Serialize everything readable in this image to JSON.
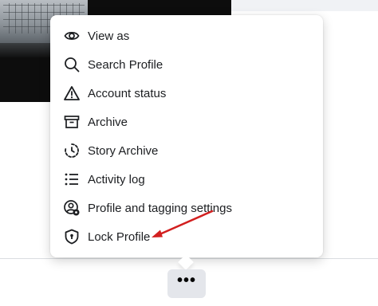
{
  "menu": {
    "items": [
      {
        "label": "View as",
        "icon": "eye-icon"
      },
      {
        "label": "Search Profile",
        "icon": "search-icon"
      },
      {
        "label": "Account status",
        "icon": "warning-icon"
      },
      {
        "label": "Archive",
        "icon": "archive-icon"
      },
      {
        "label": "Story Archive",
        "icon": "story-archive-icon"
      },
      {
        "label": "Activity log",
        "icon": "list-icon"
      },
      {
        "label": "Profile and tagging settings",
        "icon": "profile-settings-icon"
      },
      {
        "label": "Lock Profile",
        "icon": "shield-lock-icon"
      }
    ]
  },
  "more_button": {
    "label": "•••",
    "icon": "more-icon"
  },
  "colors": {
    "text": "#1c1e21",
    "menu_bg": "#ffffff",
    "button_bg": "#e4e6eb",
    "annotation_arrow": "#d21f1f"
  }
}
